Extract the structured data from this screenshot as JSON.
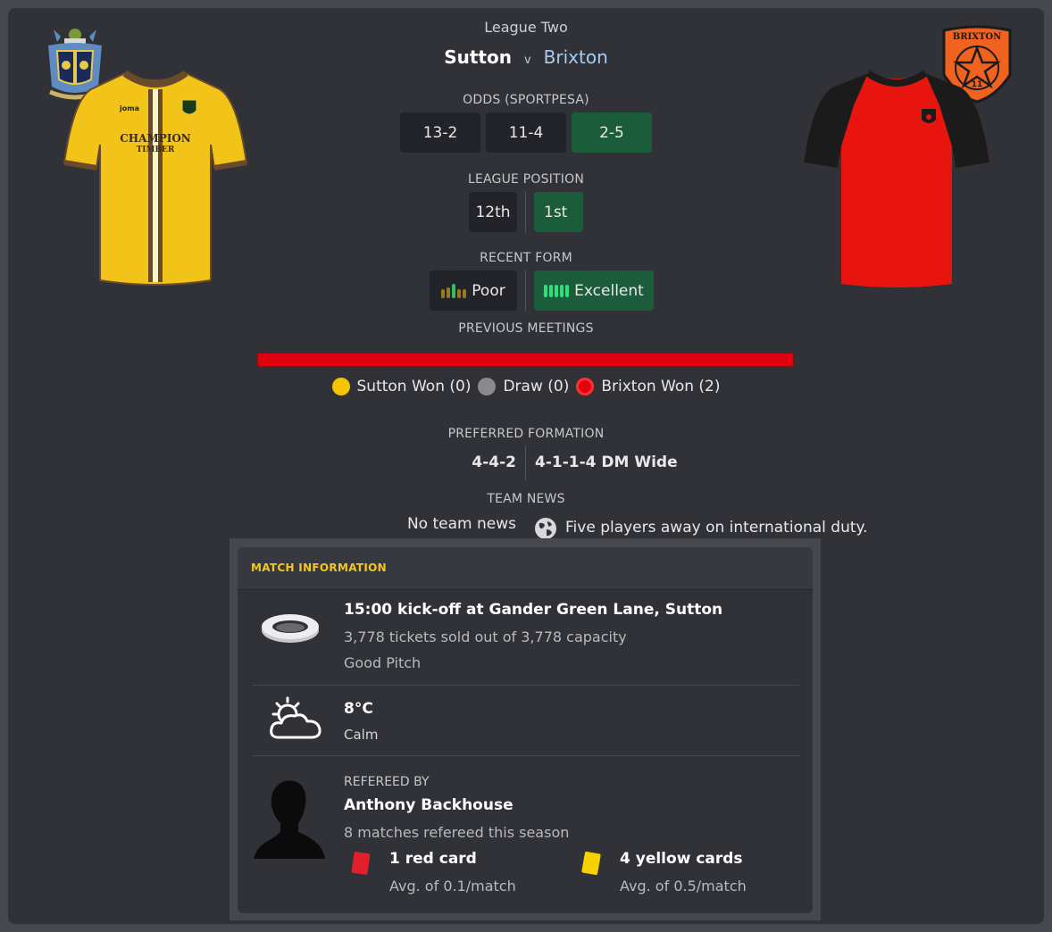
{
  "header": {
    "competition": "League Two",
    "home_team": "Sutton",
    "vs": "v",
    "away_team": "Brixton"
  },
  "odds": {
    "label": "ODDS (SPORTPESA)",
    "home": "13-2",
    "draw": "11-4",
    "away": "2-5"
  },
  "league_position": {
    "label": "LEAGUE POSITION",
    "home": "12th",
    "away": "1st"
  },
  "recent_form": {
    "label": "RECENT FORM",
    "home": "Poor",
    "away": "Excellent"
  },
  "previous_meetings": {
    "label": "PREVIOUS MEETINGS",
    "home_won": "Sutton Won (0)",
    "draw": "Draw (0)",
    "away_won": "Brixton Won (2)",
    "home_share": 0,
    "draw_share": 0,
    "away_share": 1
  },
  "preferred_formation": {
    "label": "PREFERRED FORMATION",
    "home": "4-4-2",
    "away": "4-1-1-4 DM Wide"
  },
  "team_news": {
    "label": "TEAM NEWS",
    "home": "No team news",
    "away": "Five players away on international duty."
  },
  "match_information": {
    "title": "MATCH INFORMATION",
    "venue": {
      "headline": "15:00 kick-off at Gander Green Lane, Sutton",
      "tickets": "3,778 tickets sold out of 3,778 capacity",
      "pitch": "Good Pitch"
    },
    "weather": {
      "temperature": "8°C",
      "wind": "Calm"
    },
    "referee": {
      "label": "REFEREED BY",
      "name": "Anthony Backhouse",
      "matches": "8 matches refereed this season",
      "red_cards": "1 red card",
      "red_avg": "Avg. of 0.1/match",
      "yellow_cards": "4 yellow cards",
      "yellow_avg": "Avg. of 0.5/match"
    }
  },
  "badges": {
    "away_badge_text": "BRIXTON",
    "away_badge_sub": "11"
  },
  "kits": {
    "home_sponsor_line1": "CHAMPION",
    "home_sponsor_line2": "TIMBER",
    "home_maker": "joma"
  },
  "colors": {
    "home_primary": "#f2c318",
    "home_trim": "#6b4a2a",
    "away_primary": "#e8150f",
    "away_sleeve": "#1b1b1b",
    "green_chip": "#1b5d3b",
    "meeting_bar": "#e00010",
    "accent_title": "#f2c81e"
  },
  "icons": {
    "globe": "globe-icon",
    "stadium": "stadium-icon",
    "weather": "cloud-sun-icon",
    "referee": "referee-silhouette-icon",
    "red_card": "red-card-icon",
    "yellow_card": "yellow-card-icon"
  }
}
